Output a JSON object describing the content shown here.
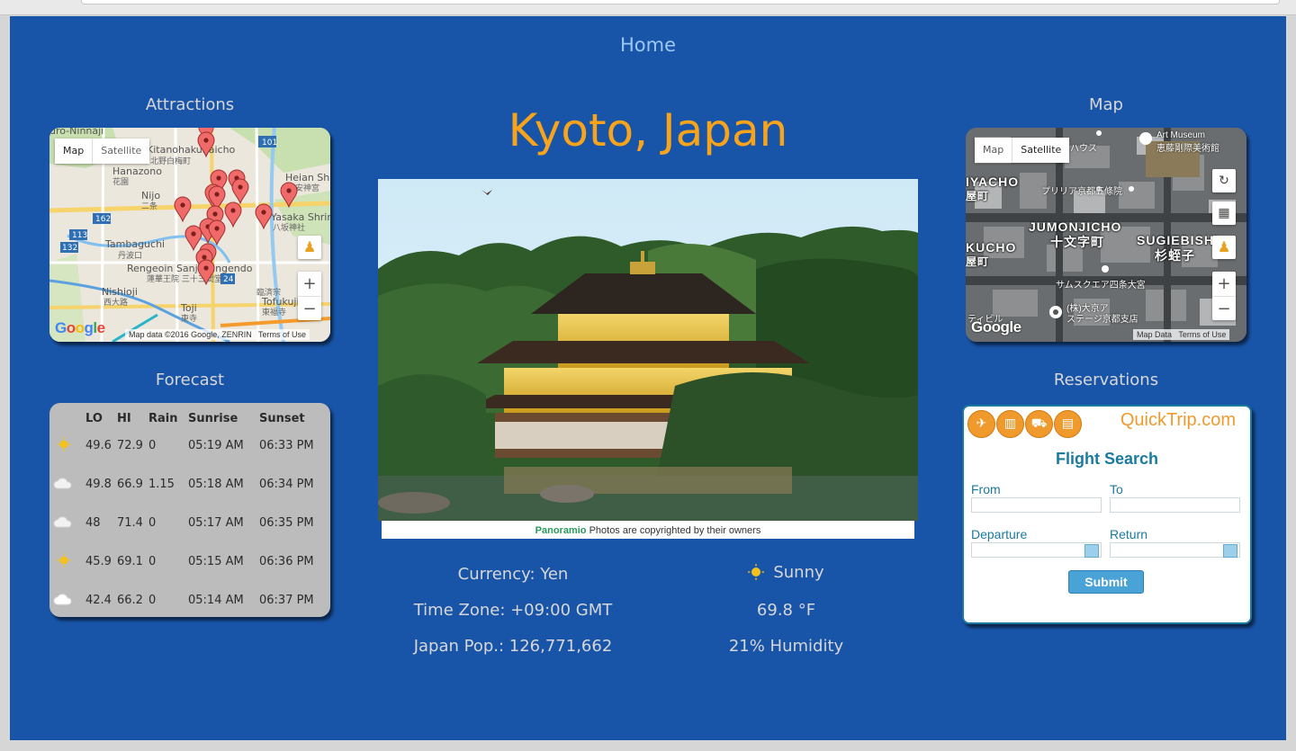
{
  "nav": {
    "home": "Home"
  },
  "city": {
    "title": "Kyoto, Japan"
  },
  "attractions": {
    "title": "Attractions",
    "map_toggle": [
      "Map",
      "Satellite"
    ],
    "place_labels": [
      "uro-Ninnaji",
      "Kitanohakubaicho",
      "北野白梅町",
      "Hanazono",
      "花園",
      "Nijo",
      "二条",
      "Tambaguchi",
      "丹波口",
      "Rengeoin Sanjusangendo",
      "蓮華王院 三十三間堂",
      "Nishioji",
      "西大路",
      "Toji",
      "東寺",
      "Yasaka Shrine",
      "八坂神社",
      "Heian Shrine",
      "平安神宮",
      "Tofukuji",
      "東福寺",
      "臨済宗"
    ],
    "road_badges": [
      "101",
      "162",
      "113",
      "132",
      "24"
    ],
    "attribution": "Map data ©2016 Google, ZENRIN",
    "terms": "Terms of Use"
  },
  "map": {
    "title": "Map",
    "map_toggle": [
      "Map",
      "Satellite"
    ],
    "area_labels": [
      "IYACHO",
      "屋町",
      "JUMONJICHO",
      "十文字町",
      "SUGIEBISHI",
      "杉蛭子",
      "KUCHO",
      "屋町"
    ],
    "poi_labels": [
      "Art Museum",
      "恵藤剛際美術館",
      "メコムハウス",
      "プリリア京都五條院",
      "サムスクエア四条大宮",
      "(株)大京ア",
      "ステージ京都支店",
      "ティビル"
    ],
    "attribution": "Map Data",
    "terms": "Terms of Use"
  },
  "forecast": {
    "title": "Forecast",
    "headers": [
      "",
      "LO",
      "HI",
      "Rain",
      "Sunrise",
      "Sunset"
    ],
    "rows": [
      {
        "icon": "sun-icon",
        "lo": "49.6",
        "hi": "72.9",
        "rain": "0",
        "sunrise": "05:19 AM",
        "sunset": "06:33 PM"
      },
      {
        "icon": "cloud-icon",
        "lo": "49.8",
        "hi": "66.9",
        "rain": "1.15",
        "sunrise": "05:18 AM",
        "sunset": "06:34 PM"
      },
      {
        "icon": "cloud-icon",
        "lo": "48",
        "hi": "71.4",
        "rain": "0",
        "sunrise": "05:17 AM",
        "sunset": "06:35 PM"
      },
      {
        "icon": "sun-icon",
        "lo": "45.9",
        "hi": "69.1",
        "rain": "0",
        "sunrise": "05:15 AM",
        "sunset": "06:36 PM"
      },
      {
        "icon": "cloud-icon",
        "lo": "42.4",
        "hi": "66.2",
        "rain": "0",
        "sunrise": "05:14 AM",
        "sunset": "06:37 PM"
      }
    ]
  },
  "photo": {
    "caption_brand": "Panoramio",
    "caption_text": "Photos are copyrighted by their owners"
  },
  "info": {
    "currency": "Currency: Yen",
    "timezone": "Time Zone: +09:00 GMT",
    "population": "Japan Pop.: 126,771,662",
    "weather": "Sunny",
    "temperature": "69.8 °F",
    "humidity": "21% Humidity"
  },
  "reservations": {
    "title": "Reservations",
    "brand": "QuickTrip.com",
    "heading": "Flight Search",
    "from_label": "From",
    "to_label": "To",
    "departure_label": "Departure",
    "return_label": "Return",
    "submit": "Submit"
  },
  "colors": {
    "page_bg": "#1854a8",
    "title_orange": "#f7a31c",
    "link_blue": "#9cc8f5",
    "marker_red": "#f16a6a"
  }
}
